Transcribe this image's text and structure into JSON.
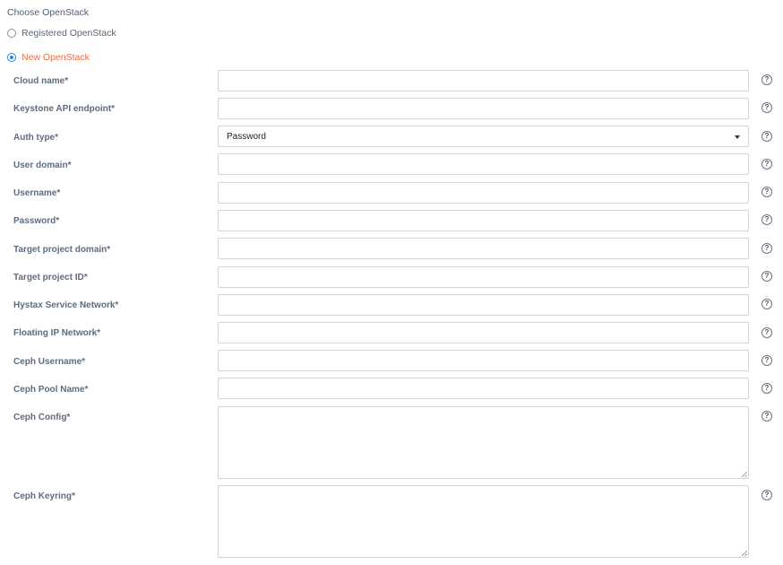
{
  "heading": "Choose OpenStack",
  "options": [
    {
      "label": "Registered OpenStack",
      "selected": false
    },
    {
      "label": "New OpenStack",
      "selected": true
    }
  ],
  "fields": {
    "cloud_name": {
      "label": "Cloud name*",
      "value": ""
    },
    "keystone": {
      "label": "Keystone API endpoint*",
      "value": ""
    },
    "auth_type": {
      "label": "Auth type*",
      "value": "Password"
    },
    "user_domain": {
      "label": "User domain*",
      "value": ""
    },
    "username": {
      "label": "Username*",
      "value": ""
    },
    "password": {
      "label": "Password*",
      "value": ""
    },
    "target_domain": {
      "label": "Target project domain*",
      "value": ""
    },
    "target_id": {
      "label": "Target project ID*",
      "value": ""
    },
    "service_network": {
      "label": "Hystax Service Network*",
      "value": ""
    },
    "floating_network": {
      "label": "Floating IP Network*",
      "value": ""
    },
    "ceph_username": {
      "label": "Ceph Username*",
      "value": ""
    },
    "ceph_pool": {
      "label": "Ceph Pool Name*",
      "value": ""
    },
    "ceph_config": {
      "label": "Ceph Config*",
      "value": ""
    },
    "ceph_keyring": {
      "label": "Ceph Keyring*",
      "value": ""
    }
  },
  "help_glyph": "?",
  "colors": {
    "accent": "#f26b3a",
    "radio_selected": "#1e88e5"
  }
}
